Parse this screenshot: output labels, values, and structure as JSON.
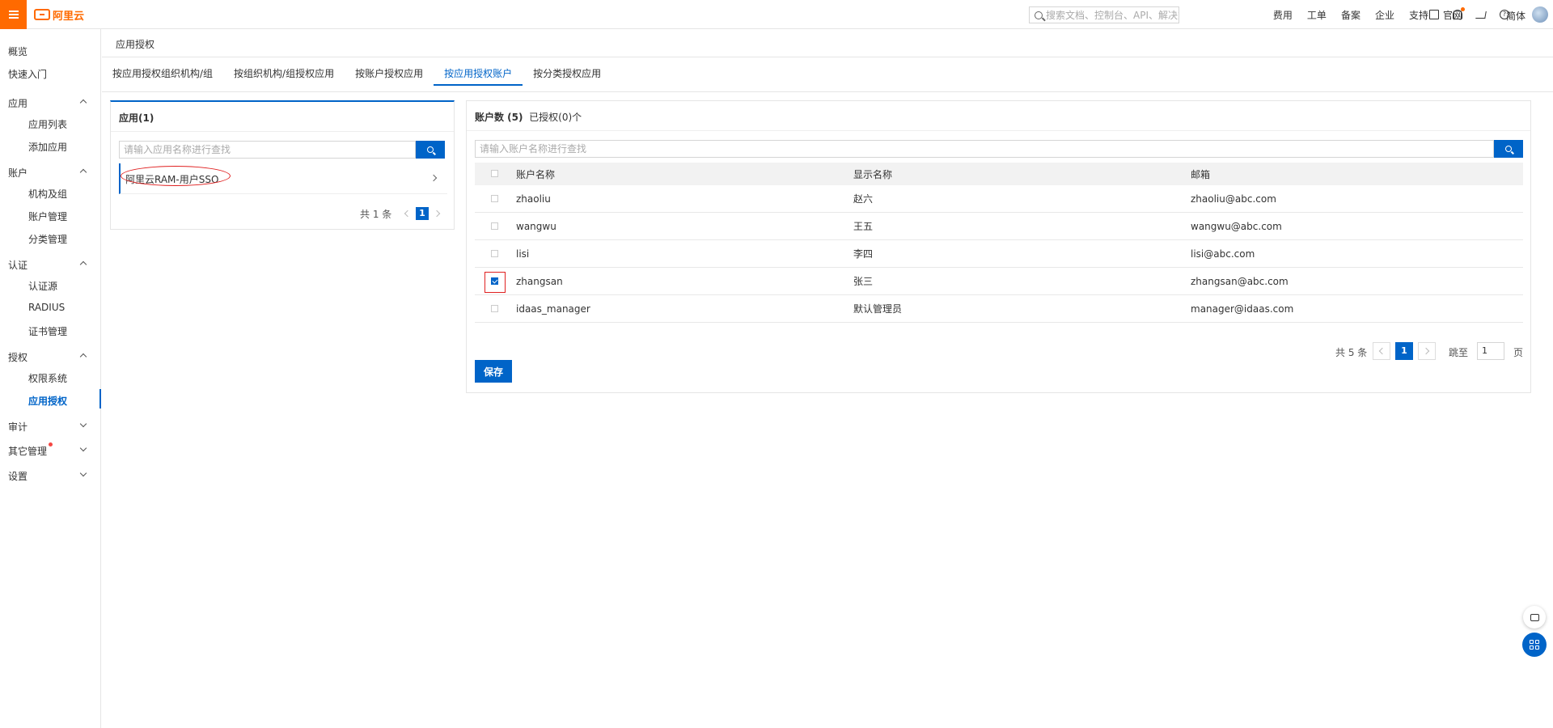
{
  "topbar": {
    "logo_text": "阿里云",
    "search_placeholder": "搜索文档、控制台、API、解决方案和资源",
    "links": [
      "费用",
      "工单",
      "备案",
      "企业",
      "支持",
      "官网"
    ],
    "icons": [
      "terminal-icon",
      "bell-icon",
      "cart-icon",
      "help-icon"
    ],
    "lang": "简体",
    "accent": "#ff6a00"
  },
  "sidebar": {
    "overview": "概览",
    "quickstart": "快速入门",
    "groups": [
      {
        "label": "应用",
        "expanded": true,
        "items": [
          "应用列表",
          "添加应用"
        ]
      },
      {
        "label": "账户",
        "expanded": true,
        "items": [
          "机构及组",
          "账户管理",
          "分类管理"
        ]
      },
      {
        "label": "认证",
        "expanded": true,
        "items": [
          "认证源",
          "RADIUS",
          "证书管理"
        ]
      },
      {
        "label": "授权",
        "expanded": true,
        "items": [
          "权限系统",
          "应用授权"
        ]
      },
      {
        "label": "审计",
        "expanded": false,
        "items": []
      },
      {
        "label": "其它管理",
        "expanded": false,
        "items": []
      },
      {
        "label": "设置",
        "expanded": false,
        "items": []
      }
    ],
    "active_item": "应用授权"
  },
  "breadcrumb": "应用授权",
  "tabs": [
    {
      "label": "按应用授权组织机构/组",
      "active": false
    },
    {
      "label": "按组织机构/组授权应用",
      "active": false
    },
    {
      "label": "按账户授权应用",
      "active": false
    },
    {
      "label": "按应用授权账户",
      "active": true
    },
    {
      "label": "按分类授权应用",
      "active": false
    }
  ],
  "apps_panel": {
    "title": "应用(1)",
    "search_placeholder": "请输入应用名称进行查找",
    "apps": [
      "阿里云RAM-用户SSO"
    ],
    "pager": {
      "total": "共 1 条",
      "current": "1"
    }
  },
  "accounts_panel": {
    "title_count": "账户数 (5)",
    "title_authorized": "已授权(0)个",
    "search_placeholder": "请输入账户名称进行查找",
    "columns": [
      "账户名称",
      "显示名称",
      "邮箱"
    ],
    "rows": [
      {
        "username": "zhaoliu",
        "display": "赵六",
        "email": "zhaoliu@abc.com",
        "checked": false
      },
      {
        "username": "wangwu",
        "display": "王五",
        "email": "wangwu@abc.com",
        "checked": false
      },
      {
        "username": "lisi",
        "display": "李四",
        "email": "lisi@abc.com",
        "checked": false
      },
      {
        "username": "zhangsan",
        "display": "张三",
        "email": "zhangsan@abc.com",
        "checked": true
      },
      {
        "username": "idaas_manager",
        "display": "默认管理员",
        "email": "manager@idaas.com",
        "checked": false
      }
    ],
    "pager": {
      "total": "共 5 条",
      "current": "1",
      "jump_label": "跳至",
      "jump_value": "1",
      "page_label": "页"
    },
    "save_label": "保存"
  },
  "colors": {
    "primary": "#0064c8",
    "highlight": "#e02020"
  }
}
